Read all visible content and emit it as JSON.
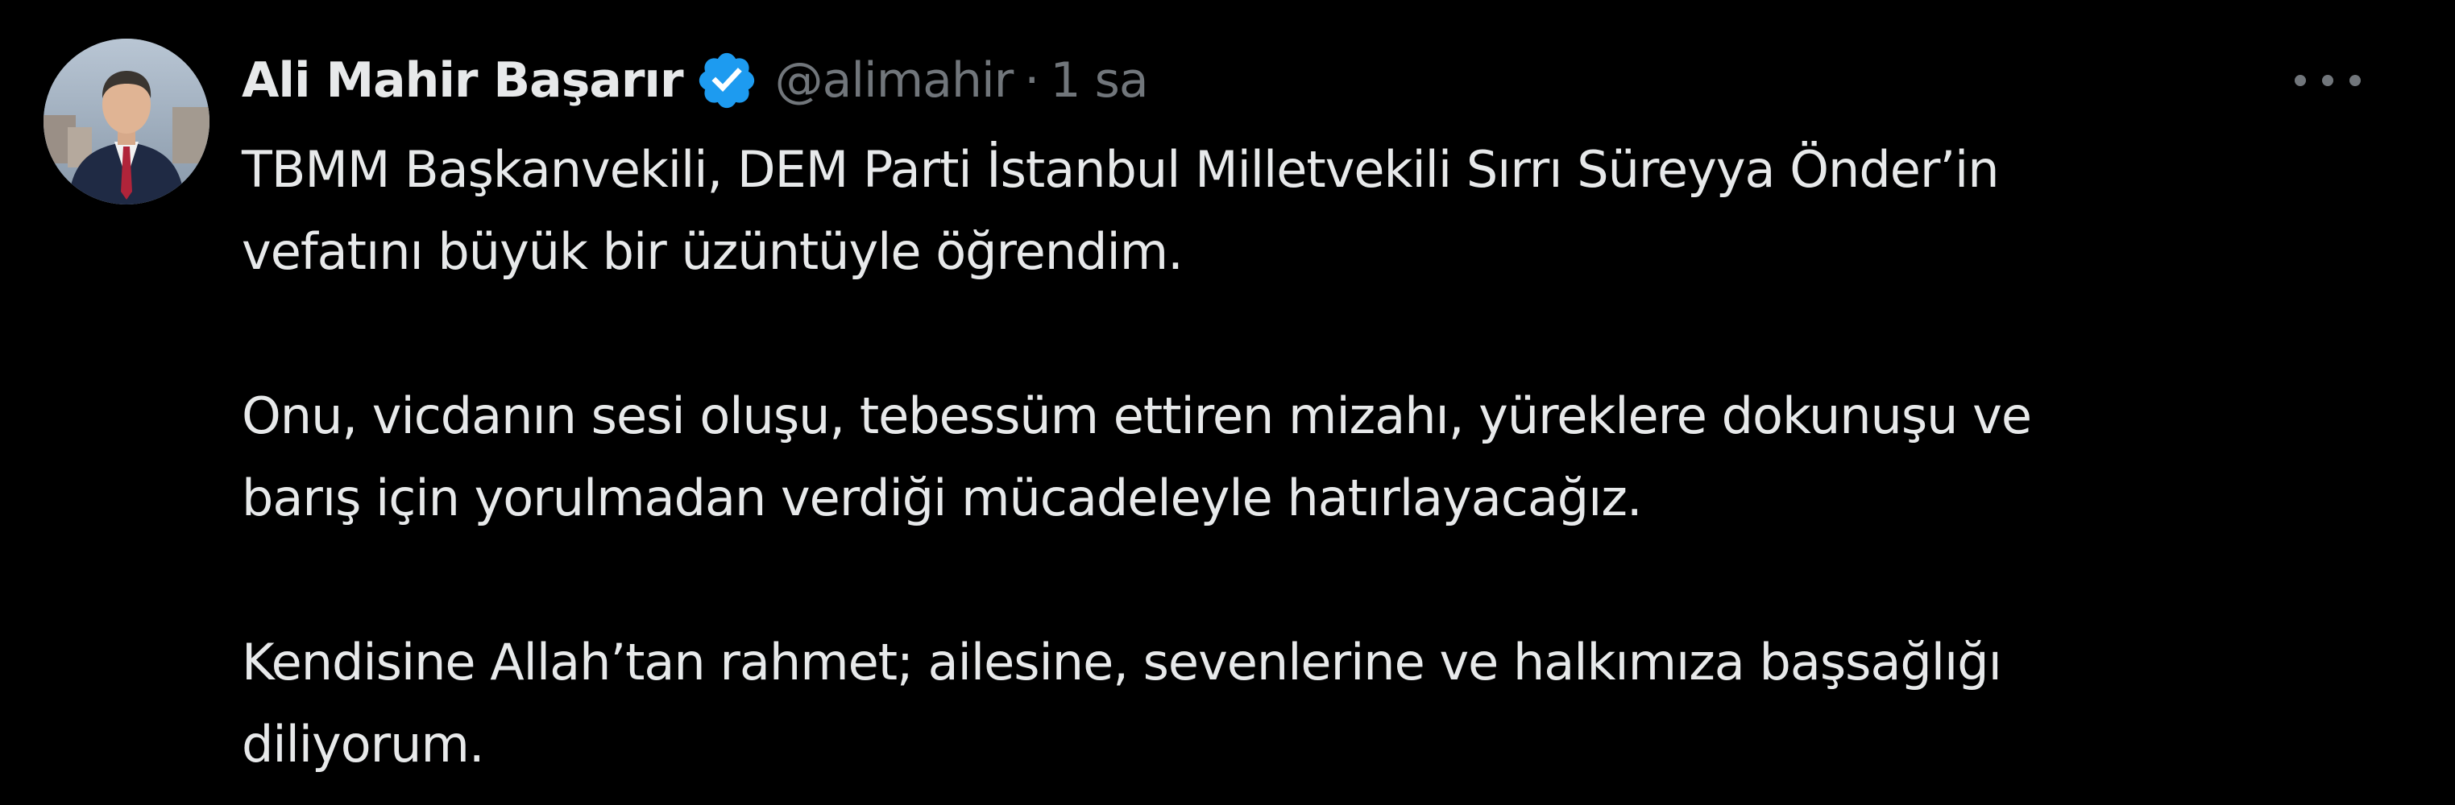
{
  "author": {
    "display_name": "Ali Mahir Başarır",
    "handle": "@alimahir",
    "separator": "·",
    "time": "1 sa",
    "verified_icon": "verified-badge-icon",
    "verified_color": "#1d9bf0"
  },
  "menu": {
    "icon": "more-options-icon"
  },
  "tweet": {
    "paragraphs": [
      "TBMM Başkanvekili, DEM Parti İstanbul Milletvekili Sırrı Süreyya Önder’in\nvefatını büyük bir üzüntüyle öğrendim.",
      "Onu, vicdanın sesi oluşu, tebessüm ettiren mizahı, yüreklere dokunuşu ve\nbarış için yorulmadan verdiği mücadeleyle hatırlayacağız.",
      "Kendisine Allah’tan rahmet; ailesine, sevenlerine ve halkımıza başsağlığı\ndiliyorum."
    ]
  },
  "colors": {
    "background": "#000000",
    "text_primary": "#e7e9ea",
    "text_secondary": "#71767b"
  }
}
